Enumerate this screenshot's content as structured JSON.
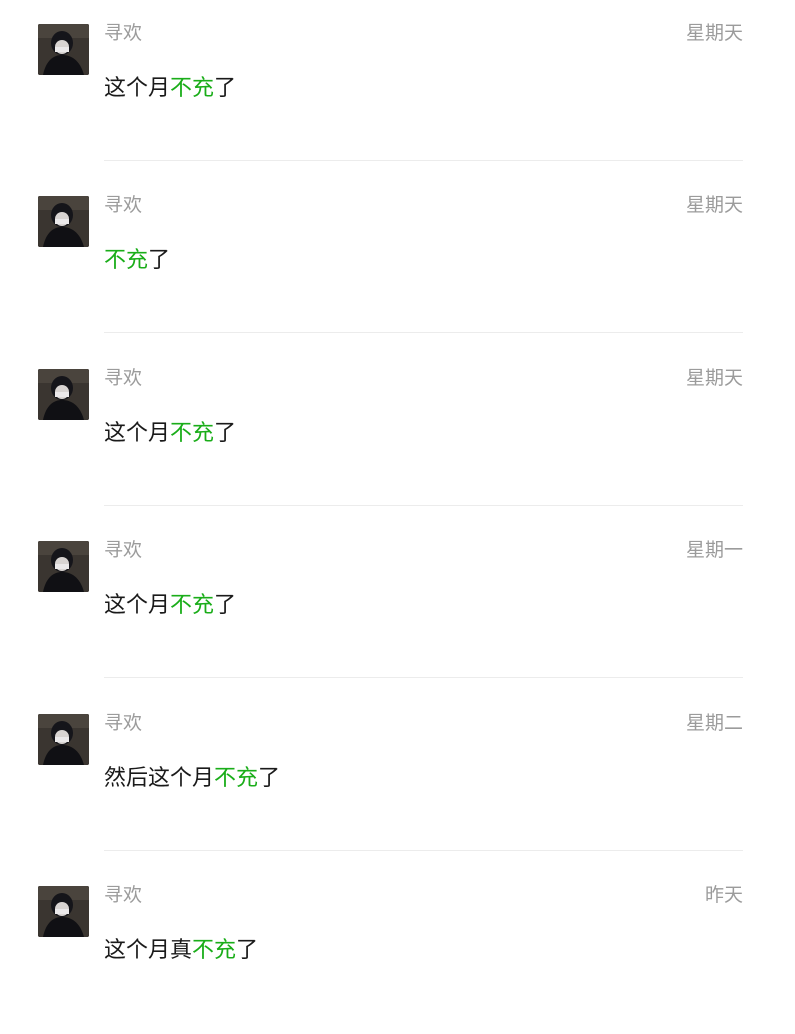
{
  "conversations": [
    {
      "sender": "寻欢",
      "time": "星期天",
      "pre": "这个月",
      "highlight": "不充",
      "post": "了"
    },
    {
      "sender": "寻欢",
      "time": "星期天",
      "pre": "",
      "highlight": "不充",
      "post": "了"
    },
    {
      "sender": "寻欢",
      "time": "星期天",
      "pre": "这个月",
      "highlight": "不充",
      "post": "了"
    },
    {
      "sender": "寻欢",
      "time": "星期一",
      "pre": "这个月",
      "highlight": "不充",
      "post": "了"
    },
    {
      "sender": "寻欢",
      "time": "星期二",
      "pre": "然后这个月",
      "highlight": "不充",
      "post": "了"
    },
    {
      "sender": "寻欢",
      "time": "昨天",
      "pre": "这个月真",
      "highlight": "不充",
      "post": "了"
    }
  ],
  "colors": {
    "highlight": "#1aad19",
    "meta_text": "#9b9b9b",
    "message_text": "#1a1a1a",
    "divider": "#ececec"
  },
  "icons": {
    "avatar": "user-avatar-photo"
  }
}
